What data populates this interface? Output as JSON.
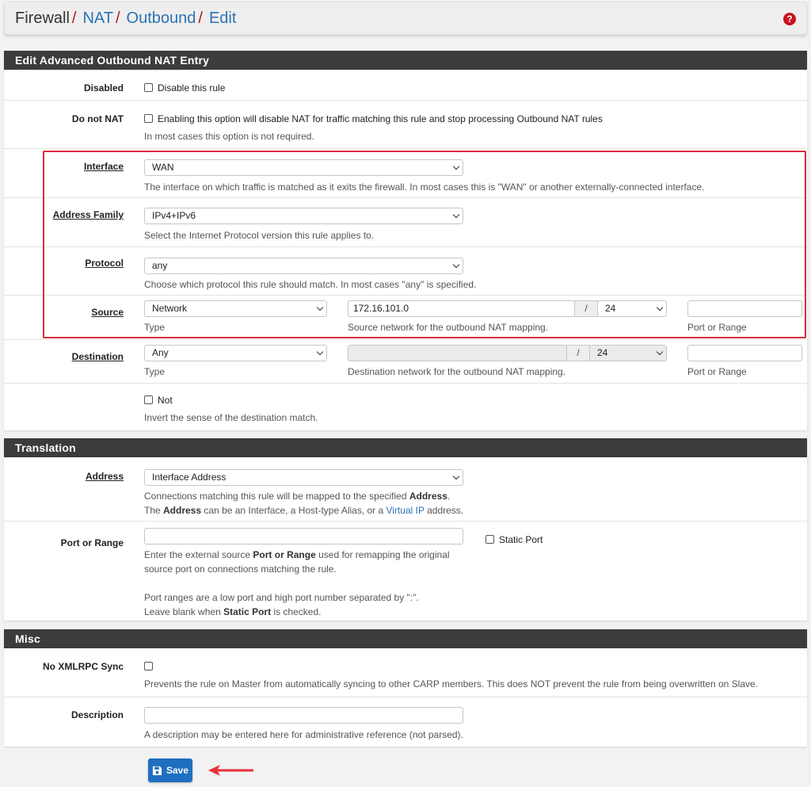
{
  "breadcrumb": {
    "items": [
      "Firewall",
      "NAT",
      "Outbound",
      "Edit"
    ],
    "separator": "/"
  },
  "help_icon": "question-circle-icon",
  "panel_main": {
    "title": "Edit Advanced Outbound NAT Entry",
    "disabled": {
      "label": "Disabled",
      "checkbox_label": "Disable this rule",
      "checked": false
    },
    "nonat": {
      "label": "Do not NAT",
      "checkbox_label": "Enabling this option will disable NAT for traffic matching this rule and stop processing Outbound NAT rules",
      "help": "In most cases this option is not required.",
      "checked": false
    },
    "interface": {
      "label": "Interface",
      "value": "WAN",
      "help": "The interface on which traffic is matched as it exits the firewall. In most cases this is \"WAN\" or another externally-connected interface."
    },
    "family": {
      "label": "Address Family",
      "value": "IPv4+IPv6",
      "help": "Select the Internet Protocol version this rule applies to."
    },
    "protocol": {
      "label": "Protocol",
      "value": "any",
      "help": "Choose which protocol this rule should match. In most cases \"any\" is specified."
    },
    "source": {
      "label": "Source",
      "type_value": "Network",
      "type_help": "Type",
      "network": "172.16.101.0",
      "slash": "/",
      "mask": "24",
      "network_help": "Source network for the outbound NAT mapping.",
      "port": "",
      "port_help": "Port or Range"
    },
    "destination": {
      "label": "Destination",
      "type_value": "Any",
      "type_help": "Type",
      "network": "",
      "slash": "/",
      "mask": "24",
      "network_help": "Destination network for the outbound NAT mapping.",
      "port": "",
      "port_help": "Port or Range"
    },
    "not": {
      "checkbox_label": "Not",
      "help": "Invert the sense of the destination match.",
      "checked": false
    }
  },
  "panel_translation": {
    "title": "Translation",
    "address": {
      "label": "Address",
      "value": "Interface Address",
      "help1_pre": "Connections matching this rule will be mapped to the specified ",
      "help1_bold": "Address",
      "help1_post": ".",
      "help2_pre": "The ",
      "help2_bold": "Address",
      "help2_mid": " can be an Interface, a Host-type Alias, or a ",
      "help2_link": "Virtual IP",
      "help2_post": " address."
    },
    "port": {
      "label": "Port or Range",
      "value": "",
      "static_port_label": "Static Port",
      "static_checked": false,
      "help1_pre": "Enter the external source ",
      "help1_bold": "Port or Range",
      "help1_post": " used for remapping the original",
      "help2": "source port on connections matching the rule.",
      "help3": "Port ranges are a low port and high port number separated by \":\".",
      "help4_pre": "Leave blank when ",
      "help4_bold": "Static Port",
      "help4_post": " is checked."
    }
  },
  "panel_misc": {
    "title": "Misc",
    "xmlrpc": {
      "label": "No XMLRPC Sync",
      "help": "Prevents the rule on Master from automatically syncing to other CARP members. This does NOT prevent the rule from being overwritten on Slave.",
      "checked": false
    },
    "description": {
      "label": "Description",
      "value": "",
      "help": "A description may be entered here for administrative reference (not parsed)."
    }
  },
  "save_button": {
    "label": "Save",
    "icon": "save-icon"
  },
  "annotations": {
    "highlight_color": "#dc2c3f",
    "arrow_color": "#e8323c",
    "accent": "#1e6fbf"
  }
}
